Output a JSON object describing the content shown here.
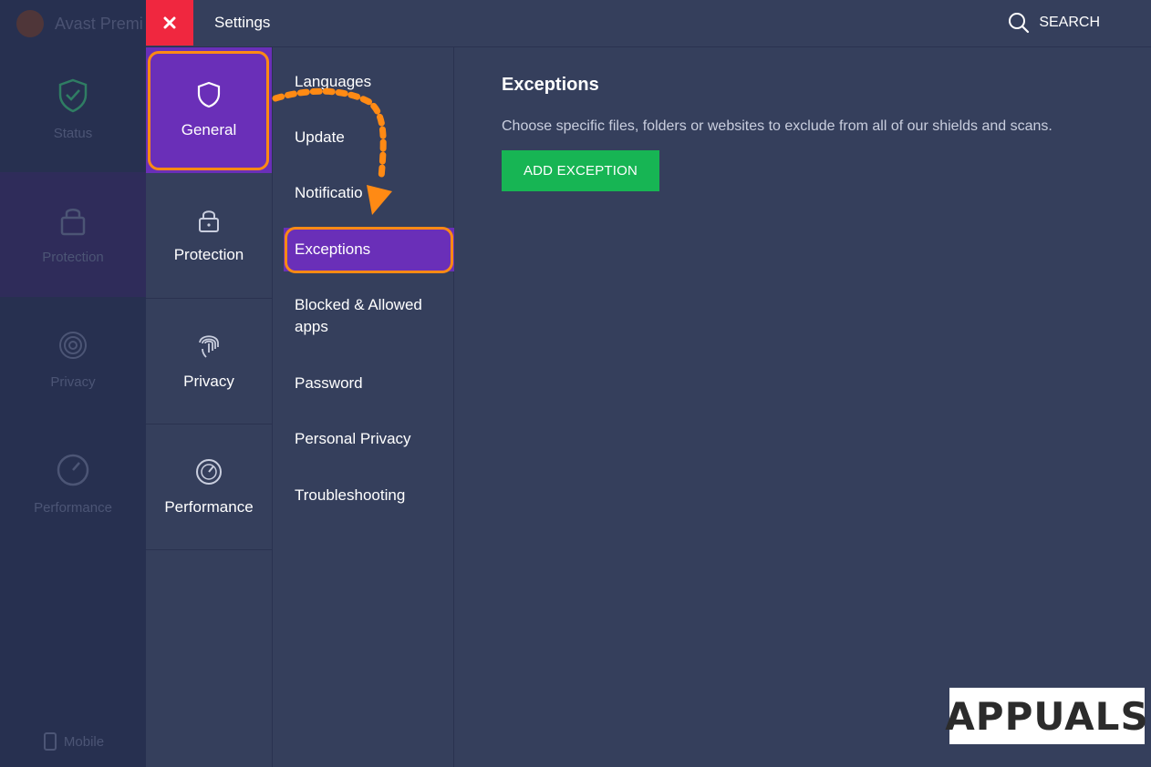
{
  "background_app": {
    "title": "Avast Premi",
    "nav": [
      {
        "label": "Status",
        "icon": "shield-check-icon"
      },
      {
        "label": "Protection",
        "icon": "lock-icon"
      },
      {
        "label": "Privacy",
        "icon": "fingerprint-icon"
      },
      {
        "label": "Performance",
        "icon": "speedometer-icon"
      }
    ],
    "mobile_label": "Mobile"
  },
  "settings": {
    "close_icon": "close-icon",
    "title": "Settings",
    "search_label": "SEARCH",
    "categories": [
      {
        "label": "General",
        "icon": "shield-icon",
        "active": true
      },
      {
        "label": "Protection",
        "icon": "lock-icon"
      },
      {
        "label": "Privacy",
        "icon": "fingerprint-icon"
      },
      {
        "label": "Performance",
        "icon": "speedometer-icon"
      }
    ],
    "subitems": [
      {
        "label": "Languages"
      },
      {
        "label": "Update"
      },
      {
        "label": "Notificatio"
      },
      {
        "label": "Exceptions",
        "active": true
      },
      {
        "label": "Blocked & Allowed apps"
      },
      {
        "label": "Password"
      },
      {
        "label": "Personal Privacy"
      },
      {
        "label": "Troubleshooting"
      }
    ],
    "content": {
      "title": "Exceptions",
      "description": "Choose specific files, folders or websites to exclude from all of our shields and scans.",
      "add_button": "ADD EXCEPTION"
    }
  },
  "watermark": {
    "text": "APPUALS"
  },
  "colors": {
    "accent_purple": "#6a2fb8",
    "highlight_orange": "#ff8a14",
    "close_red": "#f0273f",
    "button_green": "#17b554",
    "panel_bg": "#353f5c"
  }
}
